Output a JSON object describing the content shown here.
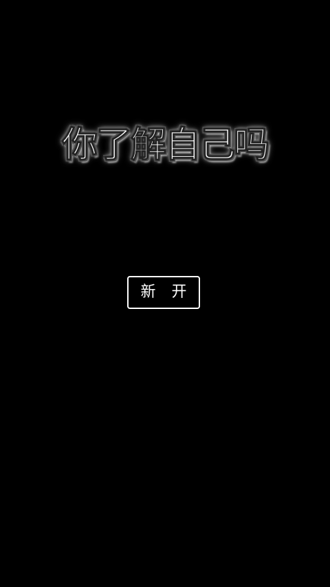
{
  "game": {
    "title": "你了解自己吗",
    "start_label": "新 开"
  },
  "colors": {
    "background": "#000000",
    "text": "#ffffff",
    "button_border": "#ffffff"
  }
}
